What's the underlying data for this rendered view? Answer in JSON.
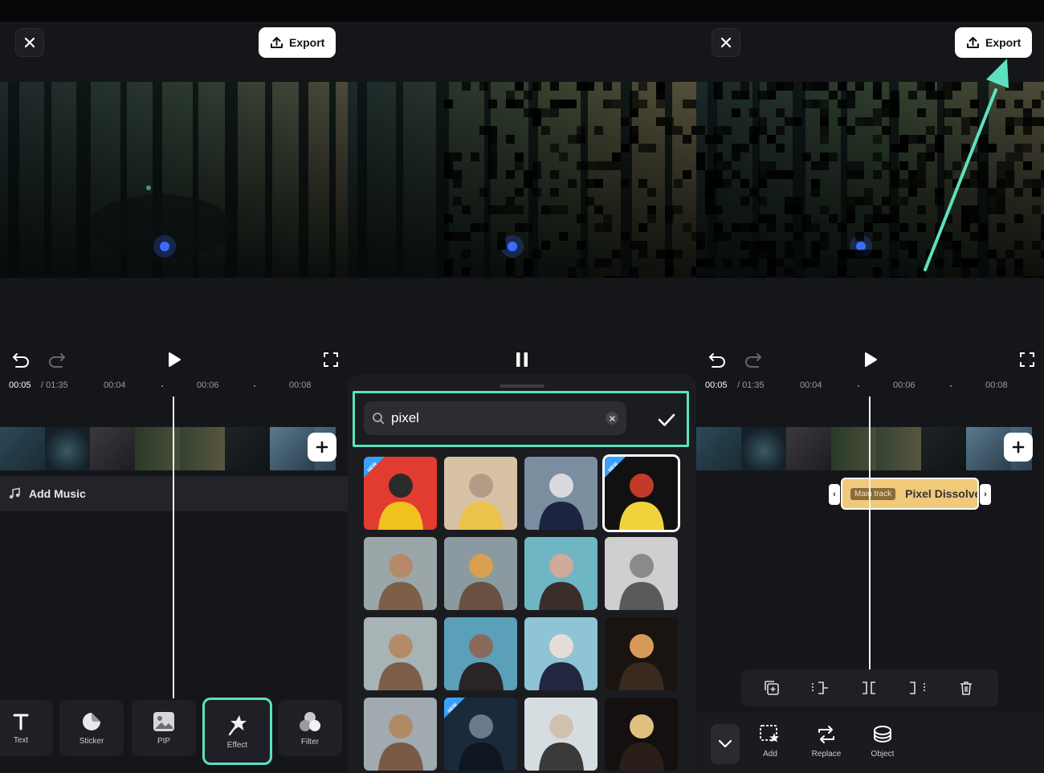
{
  "colors": {
    "accent": "#5de0c0",
    "background": "#151619",
    "clip": "#f0c97a"
  },
  "panel1": {
    "export_label": "Export",
    "timeline": {
      "current": "00:05",
      "total": "/ 01:35",
      "ticks": [
        "00:04",
        "00:06",
        "00:08"
      ]
    },
    "add_music_label": "Add Music",
    "tools": [
      {
        "label": "Text",
        "icon": "text-icon"
      },
      {
        "label": "Sticker",
        "icon": "sticker-icon"
      },
      {
        "label": "PIP",
        "icon": "pip-icon"
      },
      {
        "label": "Effect",
        "icon": "effect-icon",
        "highlighted": true
      },
      {
        "label": "Filter",
        "icon": "filter-icon"
      }
    ]
  },
  "panel2": {
    "search": {
      "value": "pixel",
      "icon": "search-icon"
    },
    "effects_grid": {
      "rows": 4,
      "cols": 4,
      "selected_index": 3,
      "new_badges": [
        0,
        3,
        13
      ],
      "new_label": "NEW"
    }
  },
  "panel3": {
    "export_label": "Export",
    "timeline": {
      "current": "00:05",
      "total": "/ 01:35",
      "ticks": [
        "00:04",
        "00:06",
        "00:08"
      ]
    },
    "effect_clip": {
      "track_label": "Main track",
      "name": "Pixel Dissolve"
    },
    "edit_tools": [
      "duplicate-icon",
      "split-left-icon",
      "split-icon",
      "split-right-icon",
      "delete-icon"
    ],
    "bottom_tools": [
      {
        "label": "Add",
        "icon": "add-effect-icon"
      },
      {
        "label": "Replace",
        "icon": "replace-icon"
      },
      {
        "label": "Object",
        "icon": "object-icon"
      }
    ]
  }
}
